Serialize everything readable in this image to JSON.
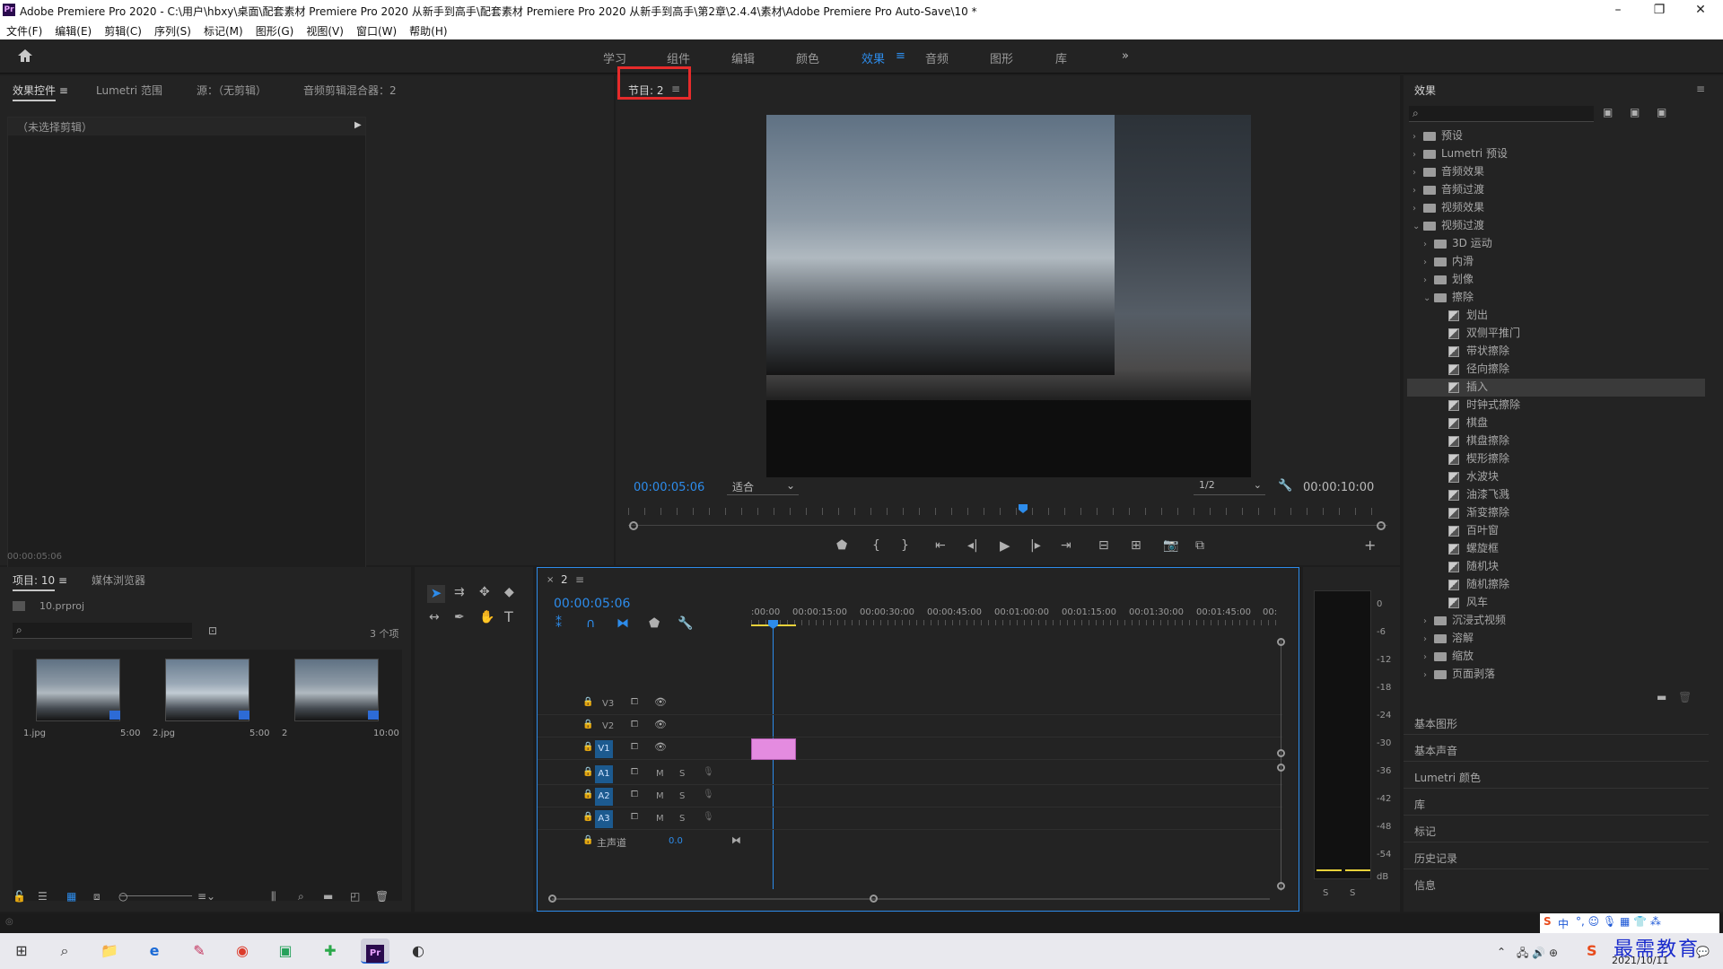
{
  "window": {
    "title": "Adobe Premiere Pro 2020 - C:\\用户\\hbxy\\桌面\\配套素材 Premiere Pro 2020 从新手到高手\\配套素材 Premiere Pro 2020 从新手到高手\\第2章\\2.4.4\\素材\\Adobe Premiere Pro Auto-Save\\10 *",
    "app_icon": "Pr"
  },
  "menu": [
    "文件(F)",
    "编辑(E)",
    "剪辑(C)",
    "序列(S)",
    "标记(M)",
    "图形(G)",
    "视图(V)",
    "窗口(W)",
    "帮助(H)"
  ],
  "workspaces": {
    "items": [
      "学习",
      "组件",
      "编辑",
      "颜色",
      "效果",
      "音频",
      "图形",
      "库"
    ],
    "active": "效果",
    "more": "»"
  },
  "effect_controls": {
    "tabs": [
      "效果控件",
      "Lumetri 范围",
      "源：（无剪辑）",
      "音频剪辑混合器：2"
    ],
    "no_clip": "（未选择剪辑）",
    "timecode": "00:00:05:06"
  },
  "program": {
    "tab": "节目: 2",
    "timecode_left": "00:00:05:06",
    "fit": "适合",
    "resolution": "1/2",
    "timecode_right": "00:00:10:00"
  },
  "project": {
    "tabs": [
      "项目: 10",
      "媒体浏览器"
    ],
    "file": "10.prproj",
    "count": "3 个项",
    "items": [
      {
        "name": "1.jpg",
        "dur": "5:00"
      },
      {
        "name": "2.jpg",
        "dur": "5:00"
      },
      {
        "name": "2",
        "dur": "10:00"
      }
    ]
  },
  "timeline": {
    "tab": "2",
    "timecode": "00:00:05:06",
    "ruler": [
      ":00:00",
      "00:00:15:00",
      "00:00:30:00",
      "00:00:45:00",
      "00:01:00:00",
      "00:01:15:00",
      "00:01:30:00",
      "00:01:45:00",
      "00:"
    ],
    "video_tracks": [
      "V3",
      "V2",
      "V1"
    ],
    "audio_tracks": [
      "A1",
      "A2",
      "A3"
    ],
    "master": "主声道",
    "master_val": "0.0",
    "m": "M",
    "s": "S"
  },
  "meter": {
    "scale": [
      "0",
      "-6",
      "-12",
      "-18",
      "-24",
      "-30",
      "-36",
      "-42",
      "-48",
      "-54",
      "dB"
    ],
    "solo": [
      "S",
      "S"
    ]
  },
  "effects": {
    "title": "效果",
    "tree": [
      {
        "label": "预设",
        "level": 0,
        "type": "folder",
        "caret": "›"
      },
      {
        "label": "Lumetri 预设",
        "level": 0,
        "type": "folder",
        "caret": "›"
      },
      {
        "label": "音频效果",
        "level": 0,
        "type": "folder",
        "caret": "›"
      },
      {
        "label": "音频过渡",
        "level": 0,
        "type": "folder",
        "caret": "›"
      },
      {
        "label": "视频效果",
        "level": 0,
        "type": "folder",
        "caret": "›"
      },
      {
        "label": "视频过渡",
        "level": 0,
        "type": "folder",
        "caret": "⌄"
      },
      {
        "label": "3D 运动",
        "level": 1,
        "type": "folder",
        "caret": "›"
      },
      {
        "label": "内滑",
        "level": 1,
        "type": "folder",
        "caret": "›"
      },
      {
        "label": "划像",
        "level": 1,
        "type": "folder",
        "caret": "›"
      },
      {
        "label": "擦除",
        "level": 1,
        "type": "folder",
        "caret": "⌄"
      },
      {
        "label": "划出",
        "level": 2,
        "type": "item"
      },
      {
        "label": "双侧平推门",
        "level": 2,
        "type": "item"
      },
      {
        "label": "带状擦除",
        "level": 2,
        "type": "item"
      },
      {
        "label": "径向擦除",
        "level": 2,
        "type": "item"
      },
      {
        "label": "插入",
        "level": 2,
        "type": "item",
        "selected": true
      },
      {
        "label": "时钟式擦除",
        "level": 2,
        "type": "item"
      },
      {
        "label": "棋盘",
        "level": 2,
        "type": "item"
      },
      {
        "label": "棋盘擦除",
        "level": 2,
        "type": "item"
      },
      {
        "label": "楔形擦除",
        "level": 2,
        "type": "item"
      },
      {
        "label": "水波块",
        "level": 2,
        "type": "item"
      },
      {
        "label": "油漆飞溅",
        "level": 2,
        "type": "item"
      },
      {
        "label": "渐变擦除",
        "level": 2,
        "type": "item"
      },
      {
        "label": "百叶窗",
        "level": 2,
        "type": "item"
      },
      {
        "label": "螺旋框",
        "level": 2,
        "type": "item"
      },
      {
        "label": "随机块",
        "level": 2,
        "type": "item"
      },
      {
        "label": "随机擦除",
        "level": 2,
        "type": "item"
      },
      {
        "label": "风车",
        "level": 2,
        "type": "item"
      },
      {
        "label": "沉浸式视频",
        "level": 1,
        "type": "folder",
        "caret": "›"
      },
      {
        "label": "溶解",
        "level": 1,
        "type": "folder",
        "caret": "›"
      },
      {
        "label": "缩放",
        "level": 1,
        "type": "folder",
        "caret": "›"
      },
      {
        "label": "页面剥落",
        "level": 1,
        "type": "folder",
        "caret": "›"
      }
    ],
    "panels": [
      "基本图形",
      "基本声音",
      "Lumetri 颜色",
      "库",
      "标记",
      "历史记录",
      "信息"
    ]
  },
  "taskbar": {
    "clock_time": "",
    "clock_date": "2021/10/11",
    "watermark": "最需教育",
    "ime": "中"
  },
  "colors": {
    "accent": "#2d8ceb",
    "highlight": "#e62b2b",
    "clip": "#e48be0"
  }
}
